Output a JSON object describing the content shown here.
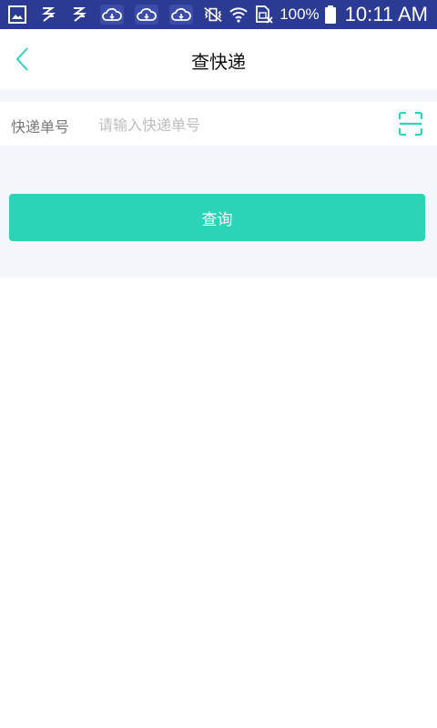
{
  "status_bar": {
    "battery": "100%",
    "time": "10:11 AM"
  },
  "header": {
    "title": "查快递"
  },
  "tracking": {
    "label": "快递单号",
    "placeholder": "请输入快递单号"
  },
  "actions": {
    "query_label": "查询"
  },
  "colors": {
    "status_bar_bg": "#2b3a93",
    "accent": "#2bd4b7",
    "section_bg": "#f3f6fa"
  }
}
